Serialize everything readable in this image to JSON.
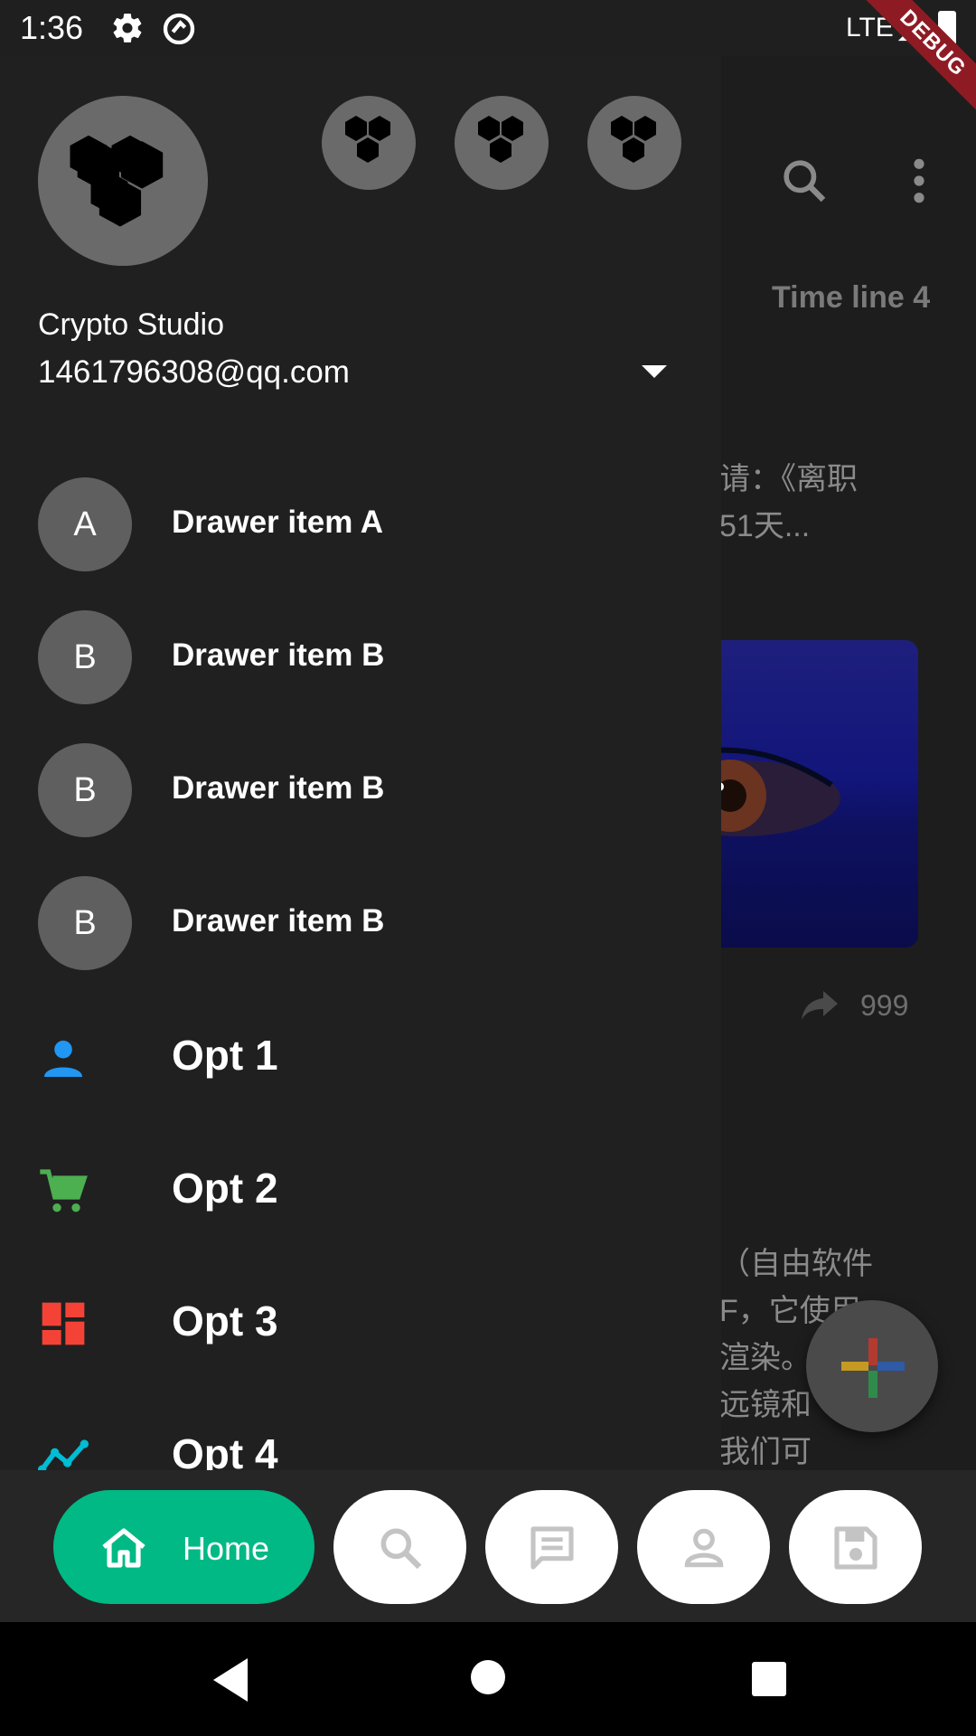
{
  "status_bar": {
    "time": "1:36",
    "network": "LTE",
    "debug_label": "DEBUG"
  },
  "background": {
    "tab_label": "Time line 4",
    "post_text_line1": "请：《离职",
    "post_text_line2": "51天...",
    "share_count": "999",
    "lower_text": [
      "（自由软件",
      "F，它使用",
      "渲染。软件",
      "远镜和",
      "我们可"
    ]
  },
  "drawer": {
    "account": {
      "name": "Crypto Studio",
      "email": "1461796308@qq.com"
    },
    "items": [
      {
        "initial": "A",
        "label": "Drawer item A"
      },
      {
        "initial": "B",
        "label": "Drawer item B"
      },
      {
        "initial": "B",
        "label": "Drawer item B"
      },
      {
        "initial": "B",
        "label": "Drawer item B"
      }
    ],
    "options": [
      {
        "label": "Opt 1",
        "icon": "person-icon",
        "color": "#2196f3"
      },
      {
        "label": "Opt 2",
        "icon": "cart-icon",
        "color": "#4caf50"
      },
      {
        "label": "Opt 3",
        "icon": "dashboard-icon",
        "color": "#f44336"
      },
      {
        "label": "Opt 4",
        "icon": "timeline-icon",
        "color": "#00bcd4"
      }
    ]
  },
  "bottom_nav": {
    "home_label": "Home",
    "accent": "#00b985",
    "icons": [
      "search-icon",
      "message-icon",
      "person-icon",
      "save-icon"
    ]
  }
}
